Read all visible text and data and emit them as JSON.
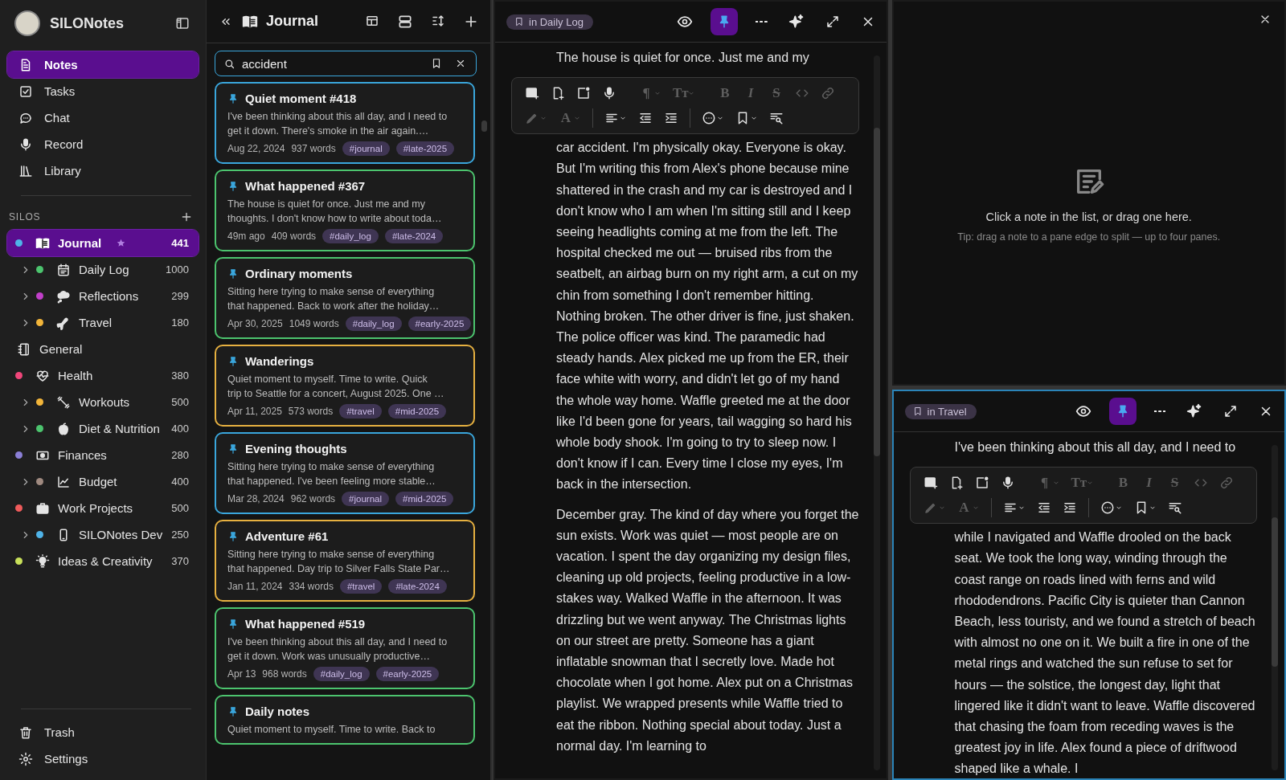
{
  "sidebar": {
    "app_name": "SILONotes",
    "nav": [
      {
        "label": "Notes",
        "kind": "notes",
        "selected": true
      },
      {
        "label": "Tasks",
        "kind": "tasks",
        "selected": false
      },
      {
        "label": "Chat",
        "kind": "chat",
        "selected": false
      },
      {
        "label": "Record",
        "kind": "record",
        "selected": false
      },
      {
        "label": "Library",
        "kind": "library",
        "selected": false
      }
    ],
    "silos_heading": "SILOS",
    "silos": [
      {
        "name": "Journal",
        "kind": "journal",
        "color": "#4fb3e8",
        "count": "441",
        "selected": true,
        "starred": true,
        "children": [
          {
            "name": "Daily Log",
            "kind": "daily",
            "color": "#4cc46e",
            "count": "1000",
            "selected": false,
            "starred": false,
            "expanded": false
          },
          {
            "name": "Reflections",
            "kind": "reflections",
            "color": "#c13fc9",
            "count": "299",
            "selected": false,
            "starred": false,
            "expanded": false
          },
          {
            "name": "Travel",
            "kind": "travel",
            "color": "#f2b53a",
            "count": "180",
            "selected": false,
            "starred": false,
            "expanded": false
          }
        ]
      },
      {
        "name": "General",
        "kind": "general",
        "selected": false,
        "starred": false
      },
      {
        "name": "Health",
        "kind": "health",
        "color": "#f0467a",
        "count": "380",
        "selected": false,
        "starred": false,
        "children": [
          {
            "name": "Workouts",
            "kind": "workouts",
            "color": "#f2b53a",
            "count": "500",
            "selected": false,
            "starred": false,
            "expanded": false
          },
          {
            "name": "Diet & Nutrition",
            "kind": "diet",
            "color": "#4cc46e",
            "count": "400",
            "selected": false,
            "starred": false,
            "expanded": false
          }
        ]
      },
      {
        "name": "Finances",
        "kind": "finances",
        "color": "#8b7fd6",
        "count": "280",
        "selected": false,
        "starred": false,
        "children": [
          {
            "name": "Budget",
            "kind": "budget",
            "color": "#a08a80",
            "count": "400",
            "selected": false,
            "starred": false,
            "expanded": false
          }
        ]
      },
      {
        "name": "Work Projects",
        "kind": "work",
        "color": "#ef5b5b",
        "count": "500",
        "selected": false,
        "starred": false,
        "children": [
          {
            "name": "SILONotes Dev",
            "kind": "dev",
            "color": "#4fb3e8",
            "count": "250",
            "selected": false,
            "starred": false,
            "expanded": false
          }
        ]
      },
      {
        "name": "Ideas & Creativity",
        "kind": "ideas",
        "color": "#c8e05a",
        "count": "370",
        "selected": false,
        "starred": false
      }
    ],
    "footer": [
      {
        "label": "Trash",
        "kind": "trash"
      },
      {
        "label": "Settings",
        "kind": "settings"
      }
    ]
  },
  "note_list": {
    "title": "Journal",
    "search": {
      "value": "accident"
    },
    "notes": [
      {
        "title": "Quiet moment #418",
        "pinned": true,
        "preview_lines": [
          "I've been thinking about this all day, and I need to",
          "get it down. There's smoke in the air again.…"
        ],
        "date": "Aug 22, 2024",
        "words": "937 words",
        "tags": [
          "#journal",
          "#late-2025"
        ],
        "color": "#3aa6dc"
      },
      {
        "title": "What happened #367",
        "pinned": true,
        "preview_lines": [
          "The house is quiet for once. Just me and my",
          "thoughts. I don't know how to write about toda…"
        ],
        "date": "49m ago",
        "words": "409 words",
        "tags": [
          "#daily_log",
          "#late-2024"
        ],
        "color": "#4cc46e"
      },
      {
        "title": "Ordinary moments",
        "pinned": true,
        "preview_lines": [
          "Sitting here trying to make sense of everything",
          "that happened. Back to work after the holiday…"
        ],
        "date": "Apr 30, 2025",
        "words": "1049 words",
        "tags": [
          "#daily_log",
          "#early-2025"
        ],
        "color": "#4cc46e"
      },
      {
        "title": "Wanderings",
        "pinned": true,
        "preview_lines": [
          "Quiet moment to myself. Time to write. Quick",
          "trip to Seattle for a concert, August 2025. One …"
        ],
        "date": "Apr 11, 2025",
        "words": "573 words",
        "tags": [
          "#travel",
          "#mid-2025"
        ],
        "color": "#e6b040"
      },
      {
        "title": "Evening thoughts",
        "pinned": true,
        "preview_lines": [
          "Sitting here trying to make sense of everything",
          "that happened. I've been feeling more stable…"
        ],
        "date": "Mar 28, 2024",
        "words": "962 words",
        "tags": [
          "#journal",
          "#mid-2025"
        ],
        "color": "#3aa6dc"
      },
      {
        "title": "Adventure #61",
        "pinned": true,
        "preview_lines": [
          "Sitting here trying to make sense of everything",
          "that happened. Day trip to Silver Falls State Par…"
        ],
        "date": "Jan 11, 2024",
        "words": "334 words",
        "tags": [
          "#travel",
          "#late-2024"
        ],
        "color": "#e6b040"
      },
      {
        "title": "What happened #519",
        "pinned": true,
        "preview_lines": [
          "I've been thinking about this all day, and I need to",
          "get it down. Work was unusually productive…"
        ],
        "date": "Apr 13",
        "words": "968 words",
        "tags": [
          "#daily_log",
          "#early-2025"
        ],
        "color": "#4cc46e"
      },
      {
        "title": "Daily notes",
        "pinned": true,
        "preview_lines": [
          "Quiet moment to myself. Time to write. Back to"
        ],
        "color": "#4cc46e"
      }
    ]
  },
  "panes": [
    {
      "kind": "editor",
      "location": "in Daily Log",
      "pinned": true,
      "focused": false,
      "lead": "The house is quiet for once. Just me and my",
      "toolbar": [
        [
          {
            "kind": "image",
            "disabled": false
          },
          {
            "kind": "file",
            "disabled": false
          },
          {
            "kind": "frame",
            "disabled": false
          },
          {
            "kind": "mic",
            "disabled": false
          },
          {
            "kind": "separator"
          },
          {
            "kind": "paragraph",
            "glyph": "¶",
            "disabled": true
          },
          {
            "kind": "textsize",
            "glyph": "Tт",
            "disabled": true
          },
          {
            "kind": "separator"
          },
          {
            "kind": "bold",
            "glyph": "B",
            "disabled": true
          },
          {
            "kind": "italic",
            "glyph": "I",
            "disabled": true
          },
          {
            "kind": "strike",
            "glyph": "S",
            "disabled": true
          },
          {
            "kind": "code",
            "disabled": true
          },
          {
            "kind": "link",
            "disabled": true
          },
          {
            "kind": "separator"
          }
        ],
        [
          {
            "kind": "highlighter",
            "disabled": true
          },
          {
            "kind": "fontcolor",
            "glyph": "A",
            "disabled": true
          },
          {
            "kind": "separator"
          },
          {
            "kind": "align",
            "disabled": false
          },
          {
            "kind": "outdent",
            "disabled": false
          },
          {
            "kind": "indent",
            "disabled": false
          },
          {
            "kind": "separator"
          },
          {
            "kind": "more",
            "disabled": false
          },
          {
            "kind": "bookmark",
            "disabled": false
          },
          {
            "kind": "find",
            "disabled": false
          }
        ]
      ],
      "paragraphs": [
        "car accident. I'm physically okay. Everyone is okay. But I'm writing this from Alex's phone because mine shattered in the crash and my car is destroyed and I don't know who I am when I'm sitting still and I keep seeing headlights coming at me from the left. The hospital checked me out — bruised ribs from the seatbelt, an airbag burn on my right arm, a cut on my chin from something I don't remember hitting. Nothing broken. The other driver is fine, just shaken. The police officer was kind. The paramedic had steady hands. Alex picked me up from the ER, their face white with worry, and didn't let go of my hand the whole way home. Waffle greeted me at the door like I'd been gone for years, tail wagging so hard his whole body shook. I'm going to try to sleep now. I don't know if I can. Every time I close my eyes, I'm back in the intersection.",
        "December gray. The kind of day where you forget the sun exists. Work was quiet — most people are on vacation. I spent the day organizing my design files, cleaning up old projects, feeling productive in a low-stakes way. Walked Waffle in the afternoon. It was drizzling but we went anyway. The Christmas lights on our street are pretty. Someone has a giant inflatable snowman that I secretly love. Made hot chocolate when I got home. Alex put on a Christmas playlist. We wrapped presents while Waffle tried to eat the ribbon. Nothing special about today. Just a normal day. I'm learning to"
      ]
    },
    {
      "kind": "empty",
      "message": "Click a note in the list, or drag one here.",
      "tip": "Tip: drag a note to a pane edge to split — up to four panes."
    },
    {
      "kind": "editor",
      "location": "in Travel",
      "pinned": true,
      "focused": true,
      "lead": "I've been thinking about this all day, and I need to",
      "toolbar": [
        [
          {
            "kind": "image",
            "disabled": false
          },
          {
            "kind": "file",
            "disabled": false
          },
          {
            "kind": "frame",
            "disabled": false
          },
          {
            "kind": "mic",
            "disabled": false
          },
          {
            "kind": "separator"
          },
          {
            "kind": "paragraph",
            "glyph": "¶",
            "disabled": true
          },
          {
            "kind": "textsize",
            "glyph": "Tт",
            "disabled": true
          },
          {
            "kind": "separator"
          },
          {
            "kind": "bold",
            "glyph": "B",
            "disabled": true
          },
          {
            "kind": "italic",
            "glyph": "I",
            "disabled": true
          },
          {
            "kind": "strike",
            "glyph": "S",
            "disabled": true
          },
          {
            "kind": "code",
            "disabled": true
          },
          {
            "kind": "link",
            "disabled": true
          },
          {
            "kind": "separator"
          }
        ],
        [
          {
            "kind": "highlighter",
            "disabled": true
          },
          {
            "kind": "fontcolor",
            "glyph": "A",
            "disabled": true
          },
          {
            "kind": "separator"
          },
          {
            "kind": "align",
            "disabled": false
          },
          {
            "kind": "outdent",
            "disabled": false
          },
          {
            "kind": "indent",
            "disabled": false
          },
          {
            "kind": "separator"
          },
          {
            "kind": "more",
            "disabled": false
          },
          {
            "kind": "bookmark",
            "disabled": false
          },
          {
            "kind": "find",
            "disabled": false
          }
        ]
      ],
      "paragraphs": [
        "while I navigated and Waffle drooled on the back seat. We took the long way, winding through the coast range on roads lined with ferns and wild rhododendrons. Pacific City is quieter than Cannon Beach, less touristy, and we found a stretch of beach with almost no one on it. We built a fire in one of the metal rings and watched the sun refuse to set for hours — the solstice, the longest day, light that lingered like it didn't want to leave. Waffle discovered that chasing the foam from receding waves is the greatest joy in life. Alex found a piece of driftwood shaped like a whale. I"
      ]
    }
  ]
}
